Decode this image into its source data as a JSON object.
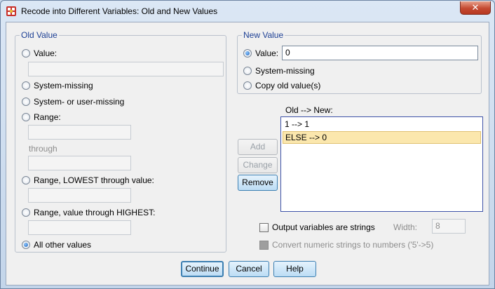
{
  "window": {
    "title": "Recode into Different Variables: Old and New Values",
    "close_glyph": "✕"
  },
  "old_value": {
    "legend": "Old Value",
    "value_label": "Value:",
    "system_missing_label": "System-missing",
    "system_or_user_missing_label": "System- or user-missing",
    "range_label": "Range:",
    "through_label": "through",
    "range_lowest_label": "Range, LOWEST through value:",
    "range_highest_label": "Range, value through HIGHEST:",
    "all_other_label": "All other values"
  },
  "new_value": {
    "legend": "New Value",
    "value_label": "Value:",
    "value_input": "0",
    "system_missing_label": "System-missing",
    "copy_old_label": "Copy old value(s)"
  },
  "mapping": {
    "label": "Old --> New:",
    "items": [
      "1 --> 1",
      "ELSE --> 0"
    ]
  },
  "side_buttons": {
    "add": "Add",
    "change": "Change",
    "remove": "Remove"
  },
  "options": {
    "output_strings_label": "Output variables are strings",
    "width_label": "Width:",
    "width_value": "8",
    "convert_label": "Convert numeric strings to numbers ('5'->5)"
  },
  "footer": {
    "continue": "Continue",
    "cancel": "Cancel",
    "help": "Help"
  }
}
